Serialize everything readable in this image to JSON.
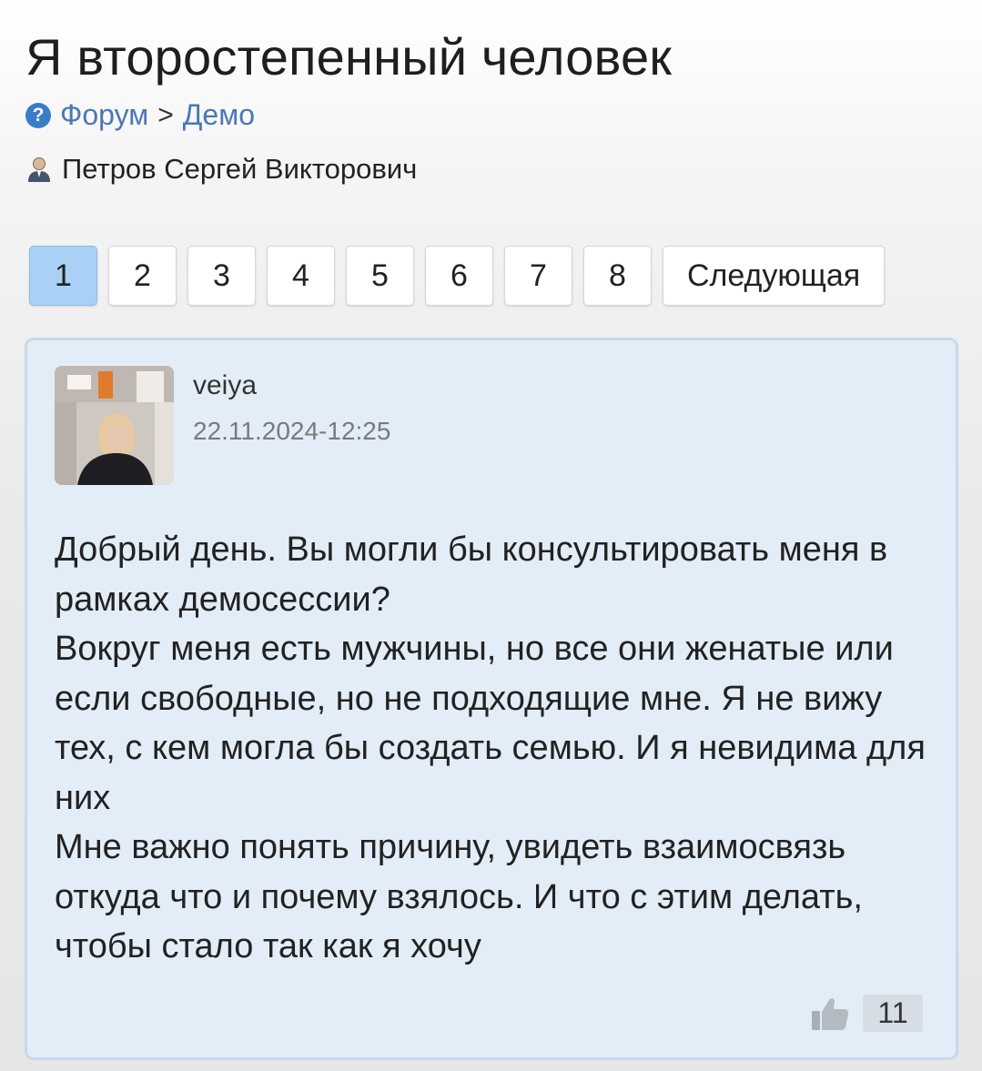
{
  "title": "Я второстепенный человек",
  "breadcrumb": {
    "items": [
      "Форум",
      "Демо"
    ],
    "separator": ">"
  },
  "author": "Петров Сергей Викторович",
  "pagination": {
    "pages": [
      "1",
      "2",
      "3",
      "4",
      "5",
      "6",
      "7",
      "8"
    ],
    "active_page": "1",
    "next_label": "Следующая"
  },
  "post": {
    "username": "veiya",
    "date": "22.11.2024-12:25",
    "paragraphs": [
      "Добрый день. Вы могли бы консультировать меня в рамках демосессии?",
      "Вокруг меня есть мужчины, но все они женатые или если свободные, но не подходящие мне. Я не вижу тех, с кем могла бы создать семью. И я невидима для них",
      "Мне важно понять причину, увидеть взаимосвязь откуда что и почему взялось. И что с этим делать, чтобы стало так как я хочу"
    ],
    "likes": "11"
  },
  "icons": {
    "help": "question-circle-icon",
    "author": "person-icon",
    "like": "thumbs-up-icon"
  },
  "colors": {
    "link": "#4a78b5",
    "active_page": "#a9d0f5",
    "card_bg": "#e3edf8",
    "card_border": "#c7d9ec"
  }
}
